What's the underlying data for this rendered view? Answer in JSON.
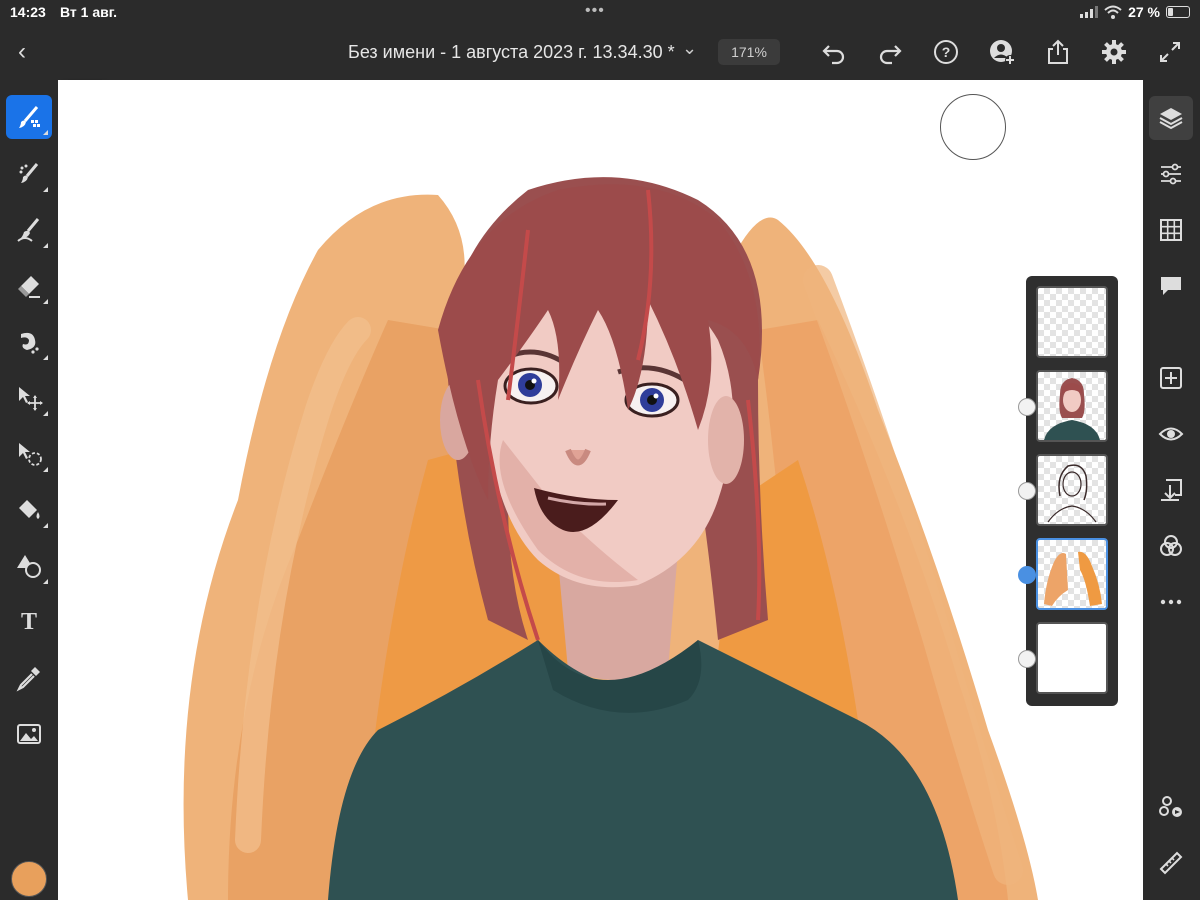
{
  "status_bar": {
    "time": "14:23",
    "date": "Вт 1 авг.",
    "battery": "27 %",
    "battery_level": 0.27
  },
  "top_bar": {
    "title": "Без имени - 1 августа 2023 г. 13.34.30 *",
    "zoom": "171%"
  },
  "brush_panel": {
    "color": "#e8a05c",
    "size": "38"
  },
  "colors": {
    "accent": "#1a73e8",
    "layer_selected": "#4a90e2",
    "current_color": "#e8a05c"
  },
  "left_tools": [
    "paint-brush-icon",
    "pixel-brush-icon",
    "smudge-icon",
    "eraser-icon",
    "liquify-icon",
    "move-icon",
    "lasso-icon",
    "fill-icon",
    "shape-icon",
    "text-icon",
    "eyedropper-icon",
    "image-icon"
  ],
  "right_tools": [
    "layers-icon",
    "adjustments-icon",
    "grid-icon",
    "comment-icon",
    "add-layer-icon",
    "visibility-icon",
    "merge-down-icon",
    "blend-mode-icon",
    "more-icon",
    "share-icon",
    "ruler-icon"
  ],
  "layers": [
    {
      "name": "empty layer",
      "selected": false
    },
    {
      "name": "portrait colour layer",
      "selected": false
    },
    {
      "name": "sketch layer",
      "selected": false
    },
    {
      "name": "orange background layer",
      "selected": true
    },
    {
      "name": "white background layer",
      "selected": false
    }
  ]
}
